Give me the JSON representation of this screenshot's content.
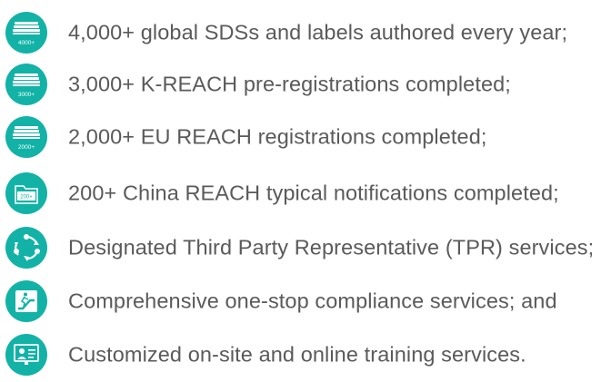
{
  "items": [
    {
      "text": "4,000+ global SDSs and labels authored every year;",
      "icon": "stacked-documents-icon",
      "badge": "4000+"
    },
    {
      "text": "3,000+ K-REACH pre-registrations completed;",
      "icon": "stacked-documents-icon",
      "badge": "3000+"
    },
    {
      "text": "2,000+ EU REACH registrations completed;",
      "icon": "stacked-documents-icon",
      "badge": "2000+"
    },
    {
      "text": "200+ China REACH typical notifications completed;",
      "icon": "folder-icon",
      "badge": "200+"
    },
    {
      "text": "Designated Third Party Representative (TPR) services;",
      "icon": "cycle-arrows-icon"
    },
    {
      "text": "Comprehensive one-stop compliance services; and",
      "icon": "escalator-icon"
    },
    {
      "text": "Customized on-site and online training services.",
      "icon": "presentation-icon"
    }
  ],
  "colors": {
    "accent": "#12b2a6",
    "text": "#5a5a5a",
    "background": "#ffffff"
  }
}
